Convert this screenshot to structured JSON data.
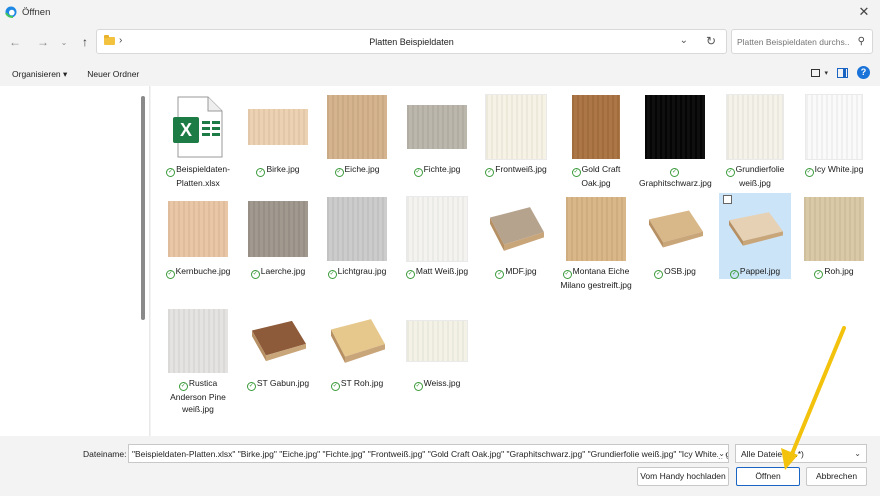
{
  "window": {
    "title": "Öffnen"
  },
  "address": {
    "path": "Platten Beispieldaten",
    "search_placeholder": "Platten Beispieldaten durchs..."
  },
  "toolbar": {
    "organize": "Organisieren ▾",
    "new_folder": "Neuer Ordner"
  },
  "files": [
    {
      "name": "Beispieldaten-Platten.xlsx",
      "kind": "excel"
    },
    {
      "name": "Birke.jpg",
      "color": "#eccfb0",
      "w": 60,
      "h": 36
    },
    {
      "name": "Eiche.jpg",
      "color": "#d2b08a",
      "w": 60,
      "h": 64
    },
    {
      "name": "Fichte.jpg",
      "color": "#b8b4aa",
      "w": 60,
      "h": 44
    },
    {
      "name": "Frontweiß.jpg",
      "color": "#f6f2e4",
      "w": 60,
      "h": 64
    },
    {
      "name": "Gold Craft Oak.jpg",
      "color": "#a9713f",
      "w": 48,
      "h": 64
    },
    {
      "name": "Graphitschwarz.jpg",
      "color": "#050505",
      "w": 60,
      "h": 64
    },
    {
      "name": "Grundierfolie weiß.jpg",
      "color": "#f4f1e8",
      "w": 56,
      "h": 64
    },
    {
      "name": "Icy White.jpg",
      "color": "#fafafa",
      "w": 56,
      "h": 64
    },
    {
      "name": "Kernbuche.jpg",
      "color": "#e7c4a2",
      "w": 60,
      "h": 56
    },
    {
      "name": "Laerche.jpg",
      "color": "#9d948a",
      "w": 60,
      "h": 56
    },
    {
      "name": "Lichtgrau.jpg",
      "color": "#cacaca",
      "w": 60,
      "h": 64
    },
    {
      "name": "Matt Weiß.jpg",
      "color": "#f4f3f0",
      "w": 60,
      "h": 64
    },
    {
      "name": "MDF.jpg",
      "kind": "board",
      "color": "#b6a38e",
      "w": 60,
      "h": 52
    },
    {
      "name": "Montana Eiche Milano gestreift.jpg",
      "color": "#d9b483",
      "w": 60,
      "h": 64
    },
    {
      "name": "OSB.jpg",
      "kind": "board",
      "color": "#d8b788",
      "w": 60,
      "h": 44
    },
    {
      "name": "Pappel.jpg",
      "kind": "board",
      "color": "#e6d1b5",
      "w": 60,
      "h": 40
    },
    {
      "name": "Roh.jpg",
      "color": "#d8c7a3",
      "w": 60,
      "h": 64
    },
    {
      "name": "Rustica Anderson Pine weiß.jpg",
      "color": "#e4e2e0",
      "w": 60,
      "h": 64
    },
    {
      "name": "ST Gabun.jpg",
      "kind": "board",
      "color": "#8d5a3a",
      "w": 60,
      "h": 48
    },
    {
      "name": "ST Roh.jpg",
      "kind": "board",
      "color": "#e6c88c",
      "w": 60,
      "h": 52
    },
    {
      "name": "Weiss.jpg",
      "color": "#f4f2e6",
      "w": 60,
      "h": 40
    }
  ],
  "bottom": {
    "filename_label": "Dateiname:",
    "filename_value": "\"Beispieldaten-Platten.xlsx\" \"Birke.jpg\" \"Eiche.jpg\" \"Fichte.jpg\" \"Frontweiß.jpg\" \"Gold Craft Oak.jpg\" \"Graphitschwarz.jpg\" \"Grundierfolie weiß.jpg\" \"Icy White.jpg",
    "filetype": "Alle Dateien (*.*)",
    "upload_label": "Vom Handy hochladen",
    "open_label": "Öffnen",
    "cancel_label": "Abbrechen"
  }
}
